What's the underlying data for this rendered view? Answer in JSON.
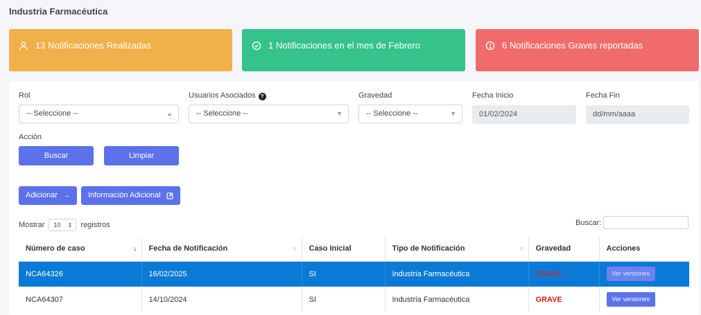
{
  "page": {
    "title": "Industria Farmacéutica"
  },
  "stats": [
    {
      "label": "13 Notificaciones Realizadas",
      "color": "#f0b14b",
      "icon": "user-icon"
    },
    {
      "label": "1 Notificaciones en el mes de Febrero",
      "color": "#35c28b",
      "icon": "check-circle-icon"
    },
    {
      "label": "6 Notificaciones Graves reportadas",
      "color": "#f26b6b",
      "icon": "alert-circle-icon"
    }
  ],
  "filters": {
    "rol": {
      "label": "Rol",
      "value": "-- Seleccione --"
    },
    "usuarios": {
      "label": "Usuarios Asociados",
      "value": "-- Seleccione --"
    },
    "gravedad": {
      "label": "Gravedad",
      "value": "-- Seleccione --"
    },
    "fecha_inicio": {
      "label": "Fecha Inicio",
      "value": "01/02/2024"
    },
    "fecha_fin": {
      "label": "Fecha Fin",
      "placeholder": "dd/mm/aaaa"
    },
    "accion_label": "Acción",
    "buscar_button": "Buscar",
    "limpiar_button": "Limpiar"
  },
  "actions": {
    "adicionar": "Adicionar",
    "info_adicional": "Información Adicional"
  },
  "table_controls": {
    "mostrar": "Mostrar",
    "page_length": "10",
    "registros": "registros",
    "buscar": "Buscar:"
  },
  "table": {
    "headers": [
      "Número de caso",
      "Fecha de Notificación",
      "Caso Inicial",
      "Tipo de Notificación",
      "Gravedad",
      "Acciones"
    ],
    "rows": [
      {
        "caso": "NCA64326",
        "fecha": "16/02/2025",
        "inicial": "SI",
        "tipo": "Industria Farmacéutica",
        "gravedad": "GRAVE",
        "accion": "Ver versiones"
      },
      {
        "caso": "NCA64307",
        "fecha": "14/10/2024",
        "inicial": "SI",
        "tipo": "Industria Farmacéutica",
        "gravedad": "GRAVE",
        "accion": "Ver versiones"
      }
    ]
  },
  "colors": {
    "accent": "#5c72ea",
    "selected_row": "#0b7ad6",
    "severity": "#e01a1a"
  }
}
